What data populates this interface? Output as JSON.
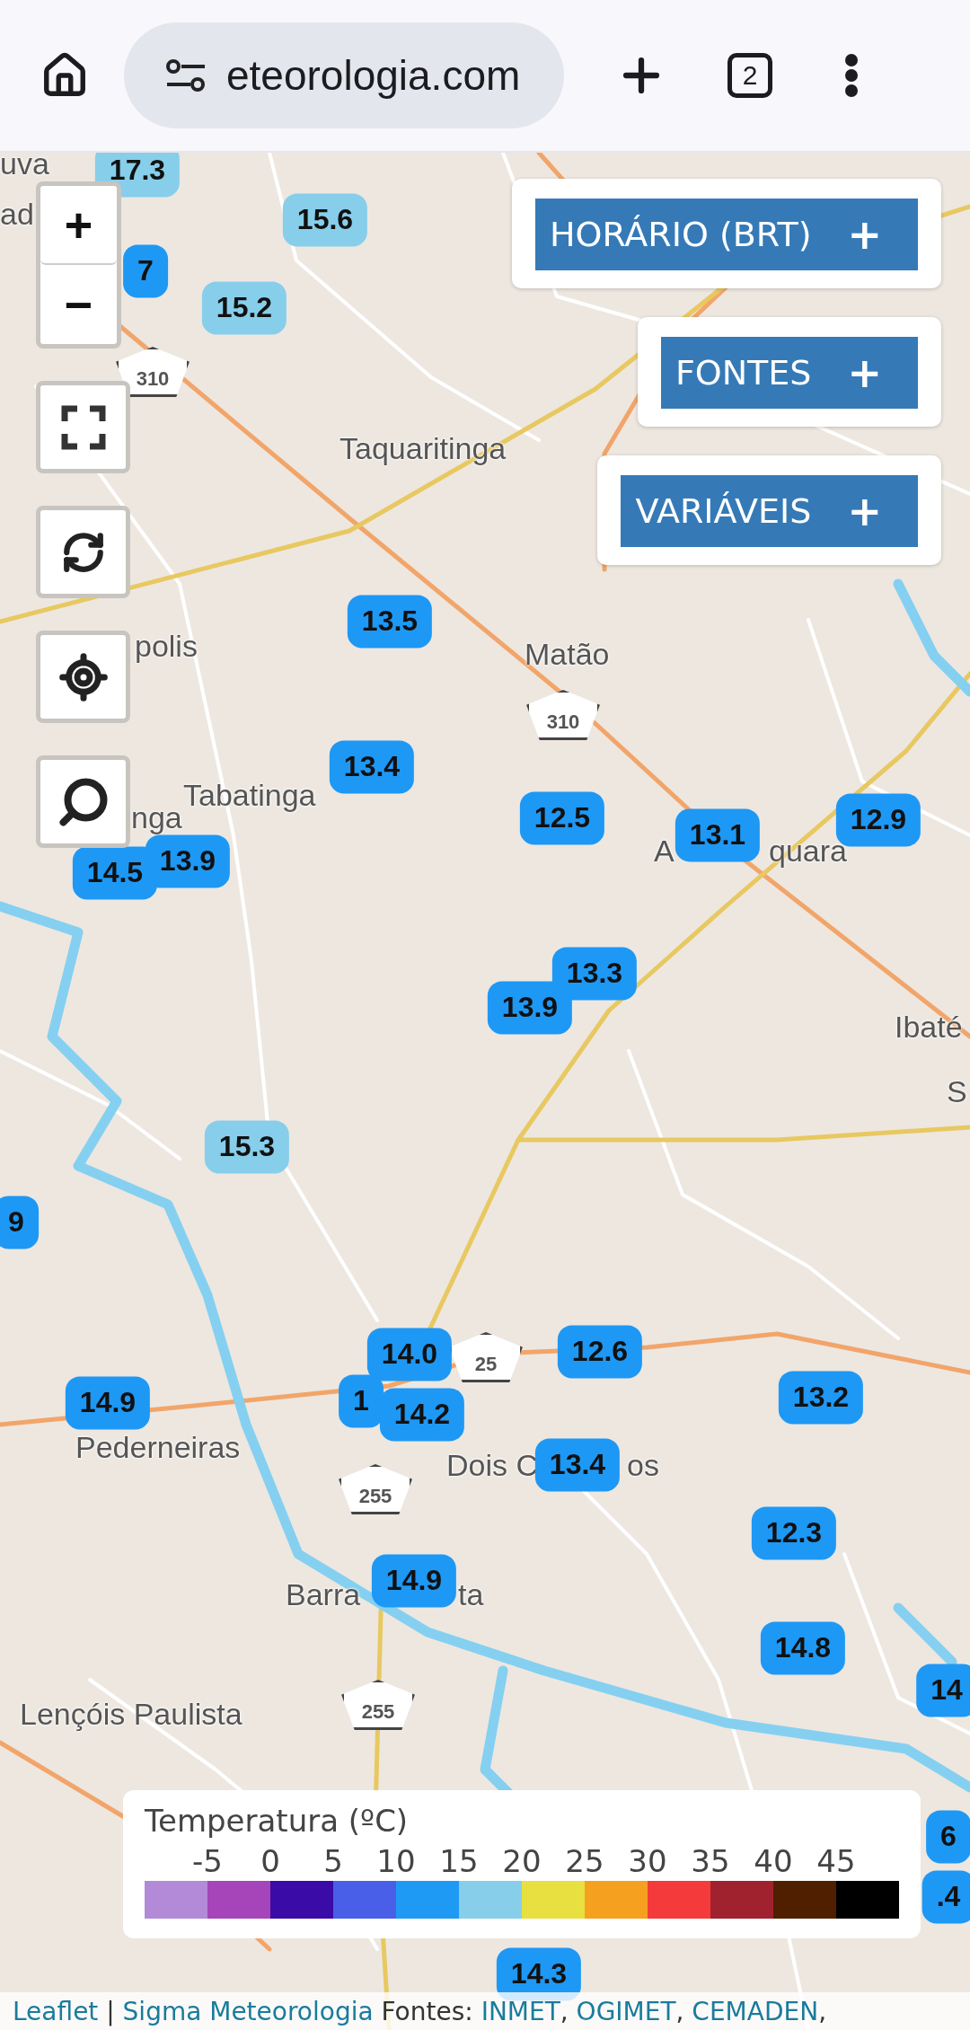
{
  "browser": {
    "url": "eteorologia.com",
    "tab_count": "2"
  },
  "map_controls": {
    "zoom_in": "+",
    "zoom_out": "−"
  },
  "panels": [
    {
      "label": "HORÁRIO (BRT)",
      "toggle": "+"
    },
    {
      "label": "FONTES",
      "toggle": "+"
    },
    {
      "label": "VARIÁVEIS",
      "toggle": "+"
    }
  ],
  "place_labels": [
    {
      "text": "uva"
    },
    {
      "text": "ad"
    },
    {
      "text": "Taquaritinga"
    },
    {
      "text": "Matão"
    },
    {
      "text": "polis"
    },
    {
      "text": "Tabatinga"
    },
    {
      "text": "nga"
    },
    {
      "text": "A"
    },
    {
      "text": "quara"
    },
    {
      "text": "Ibaté"
    },
    {
      "text": "S"
    },
    {
      "text": "Pederneiras"
    },
    {
      "text": "Dois C"
    },
    {
      "text": "os"
    },
    {
      "text": "Barra"
    },
    {
      "text": "ta"
    },
    {
      "text": "Lençóis Paulista"
    }
  ],
  "road_shields": [
    {
      "text": "310"
    },
    {
      "text": "310"
    },
    {
      "text": "25"
    },
    {
      "text": "255"
    },
    {
      "text": "255"
    }
  ],
  "markers": [
    {
      "value": "17.3",
      "color": "#87ceeb"
    },
    {
      "value": "7",
      "color": "#1e98f5"
    },
    {
      "value": "15.6",
      "color": "#87ceeb"
    },
    {
      "value": "15.2",
      "color": "#87ceeb"
    },
    {
      "value": "13.5",
      "color": "#1e98f5"
    },
    {
      "value": "13.4",
      "color": "#1e98f5"
    },
    {
      "value": "12.5",
      "color": "#1e98f5"
    },
    {
      "value": "13.1",
      "color": "#1e98f5"
    },
    {
      "value": "12.9",
      "color": "#1e98f5"
    },
    {
      "value": "14.5",
      "color": "#1e98f5"
    },
    {
      "value": "13.9",
      "color": "#1e98f5"
    },
    {
      "value": "13.3",
      "color": "#1e98f5"
    },
    {
      "value": "13.9",
      "color": "#1e98f5"
    },
    {
      "value": "15.3",
      "color": "#87ceeb"
    },
    {
      "value": "9",
      "color": "#1e98f5"
    },
    {
      "value": "14.0",
      "color": "#1e98f5"
    },
    {
      "value": "1",
      "color": "#1e98f5"
    },
    {
      "value": "14.2",
      "color": "#1e98f5"
    },
    {
      "value": "12.6",
      "color": "#1e98f5"
    },
    {
      "value": "14.9",
      "color": "#1e98f5"
    },
    {
      "value": "13.2",
      "color": "#1e98f5"
    },
    {
      "value": "13.4",
      "color": "#1e98f5"
    },
    {
      "value": "12.3",
      "color": "#1e98f5"
    },
    {
      "value": "14.9",
      "color": "#1e98f5"
    },
    {
      "value": "14.8",
      "color": "#1e98f5"
    },
    {
      "value": "14",
      "color": "#1e98f5"
    },
    {
      "value": "6",
      "color": "#1e98f5"
    },
    {
      "value": ".4",
      "color": "#1e98f5"
    },
    {
      "value": "14.3",
      "color": "#1e98f5"
    }
  ],
  "legend": {
    "title": "Temperatura (ºC)",
    "ticks": [
      "-5",
      "0",
      "5",
      "10",
      "15",
      "20",
      "25",
      "30",
      "35",
      "40",
      "45"
    ],
    "scale": [
      {
        "color": "#b28ad8"
      },
      {
        "color": "#a545b9"
      },
      {
        "color": "#3a0ba6"
      },
      {
        "color": "#4a5fe8"
      },
      {
        "color": "#1e9af5"
      },
      {
        "color": "#87ceeb"
      },
      {
        "color": "#e8e040"
      },
      {
        "color": "#f6a020"
      },
      {
        "color": "#f43a3a"
      },
      {
        "color": "#a0222e"
      },
      {
        "color": "#4f1f00"
      },
      {
        "color": "#000000"
      }
    ]
  },
  "attribution": [
    {
      "text": "Leaflet",
      "kind": "link"
    },
    {
      "text": " | ",
      "kind": "text"
    },
    {
      "text": "Sigma Meteorologia",
      "kind": "link"
    },
    {
      "text": " Fontes: ",
      "kind": "text"
    },
    {
      "text": "INMET",
      "kind": "link"
    },
    {
      "text": ", ",
      "kind": "text"
    },
    {
      "text": "OGIMET",
      "kind": "link"
    },
    {
      "text": ", ",
      "kind": "text"
    },
    {
      "text": "CEMADEN",
      "kind": "link"
    },
    {
      "text": ",",
      "kind": "text"
    }
  ]
}
